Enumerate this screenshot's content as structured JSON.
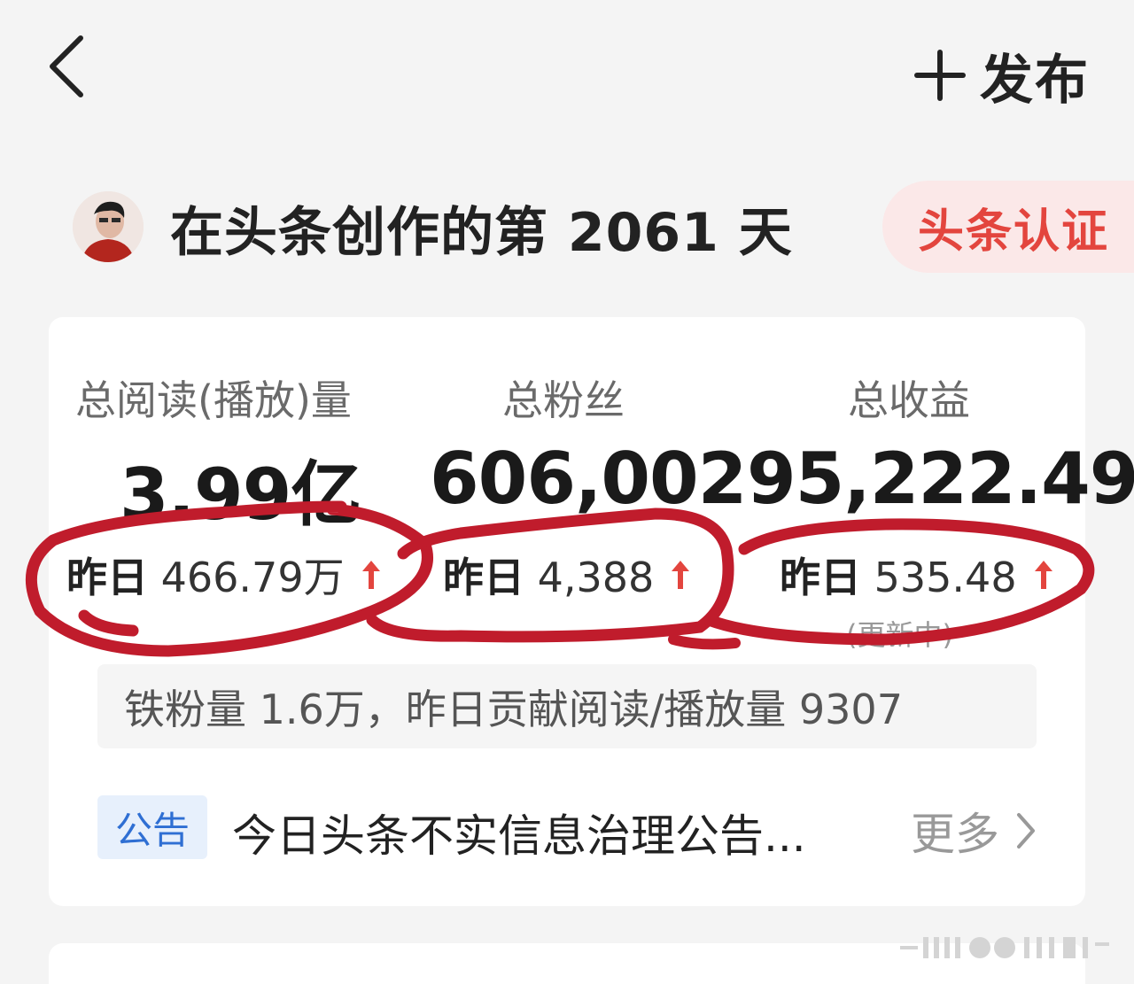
{
  "header": {
    "publish_label": "发布"
  },
  "creator": {
    "title": "在头条创作的第 2061 天",
    "cert_label": "头条认证"
  },
  "stats": [
    {
      "label": "总阅读(播放)量",
      "value": "3.99亿",
      "yday_prefix": "昨日",
      "yday_value": "466.79万"
    },
    {
      "label": "总粉丝",
      "value": "606,002",
      "yday_prefix": "昨日",
      "yday_value": "4,388"
    },
    {
      "label": "总收益",
      "value": "95,222.49",
      "yday_prefix": "昨日",
      "yday_value": "535.48",
      "note": "(更新中)"
    }
  ],
  "fans_bar": {
    "text": "铁粉量 1.6万，昨日贡献阅读/播放量 9307"
  },
  "notice": {
    "tag": "公告",
    "text": "今日头条不实信息治理公告...",
    "more_label": "更多"
  },
  "colors": {
    "accent_red": "#e3453e",
    "annotation_red": "#c01c2c",
    "notice_blue": "#2f6fd3"
  },
  "icons": [
    "back-chevron-icon",
    "plus-icon",
    "arrow-up-icon",
    "chevron-right-icon"
  ]
}
